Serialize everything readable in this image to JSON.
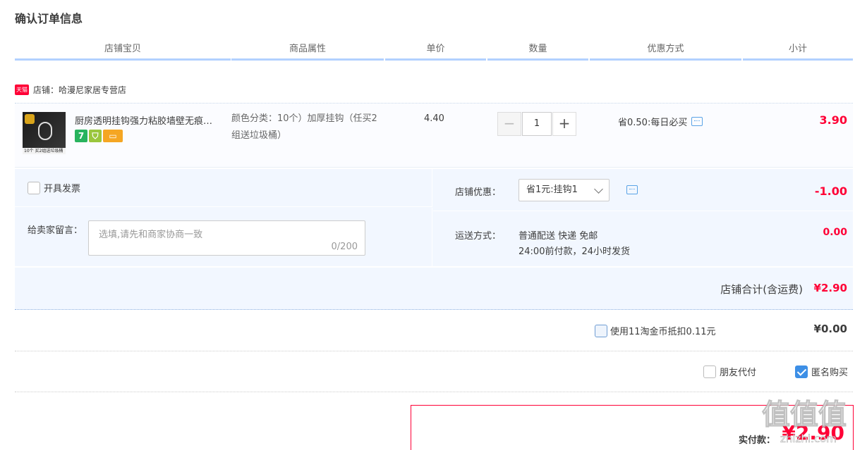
{
  "page": {
    "title": "确认订单信息"
  },
  "columns": [
    "店铺宝贝",
    "商品属性",
    "单价",
    "数量",
    "优惠方式",
    "小计"
  ],
  "shop": {
    "badge": "天猫",
    "name": "店铺：哈漫尼家居专营店"
  },
  "item": {
    "title": "厨房透明挂钩强力粘胶墙壁无痕…",
    "thumb_caption": "10个 买2组送垃圾桶",
    "service_icons": [
      "seven-day-return-icon",
      "guarantee-icon",
      "credit-card-icon"
    ],
    "attr": "颜色分类：10个）加厚挂钩（任买2组送垃圾桶）",
    "price": "4.40",
    "qty_minus": "−",
    "qty": "1",
    "qty_plus": "+",
    "discount": "省0.50:每日必买",
    "subtotal": "3.90"
  },
  "extras": {
    "invoice_label": "开具发票",
    "invoice_checked": false,
    "memo_label": "给卖家留言：",
    "memo_placeholder": "选填,请先和商家协商一致",
    "memo_count": "0/200",
    "shop_promo_label": "店铺优惠：",
    "shop_promo_value": "省1元:挂钩1",
    "shop_promo_amount": "-1.00",
    "shipping_label": "运送方式：",
    "shipping_method": "普通配送 快递 免邮",
    "shipping_time": "24:00前付款，24小时发货",
    "shipping_amount": "0.00"
  },
  "shop_total": {
    "label": "店铺合计(含运费)",
    "amount": "¥2.90"
  },
  "coins": {
    "label": "使用11淘金币抵扣0.11元",
    "checked": false,
    "amount": "¥0.00"
  },
  "options": {
    "friend_pay_label": "朋友代付",
    "friend_pay_checked": false,
    "anonymous_label": "匿名购买",
    "anonymous_checked": true
  },
  "payment": {
    "label": "实付款：",
    "amount": "¥2.90"
  },
  "watermark": {
    "chars": "值值值",
    "url": "zhizhi.com"
  },
  "colors": {
    "accent_red": "#ff0036",
    "header_underline": "#b2d1ff",
    "panel_bg": "#f2f7ff",
    "checkbox_blue": "#3d8fe6"
  }
}
